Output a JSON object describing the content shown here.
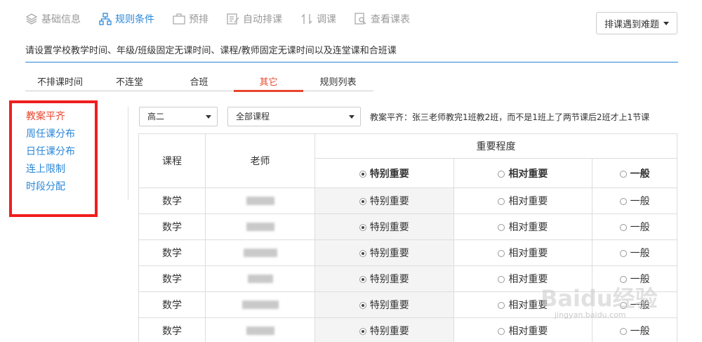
{
  "nav": {
    "items": [
      {
        "label": "基础信息",
        "icon": "layers-icon",
        "active": false
      },
      {
        "label": "规则条件",
        "icon": "sitemap-icon",
        "active": true
      },
      {
        "label": "预排",
        "icon": "briefcase-icon",
        "active": false
      },
      {
        "label": "自动排课",
        "icon": "edit-icon",
        "active": false
      },
      {
        "label": "调课",
        "icon": "swap-icon",
        "active": false
      },
      {
        "label": "查看课表",
        "icon": "search-doc-icon",
        "active": false
      }
    ],
    "trouble_label": "排课遇到难题"
  },
  "description": "请设置学校教学时间、年级/班级固定无课时间、课程/教师固定无课时间以及连堂课和合班课",
  "subtabs": [
    "不排课时间",
    "不连堂",
    "合班",
    "其它",
    "规则列表"
  ],
  "active_subtab": "其它",
  "leftmenu": [
    "教案平齐",
    "周任课分布",
    "日任课分布",
    "连上限制",
    "时段分配"
  ],
  "filters": {
    "grade": "高二",
    "course": "全部课程",
    "hint": "教案平齐：张三老师教完1班教2班，而不是1班上了两节课后2班才上1节课"
  },
  "table": {
    "headers": {
      "course": "课程",
      "teacher": "老师",
      "importance": "重要程度",
      "levels": [
        "特别重要",
        "相对重要",
        "一般"
      ]
    },
    "rows": [
      {
        "course": "数学",
        "selected": "特别重要"
      },
      {
        "course": "数学",
        "selected": "特别重要"
      },
      {
        "course": "数学",
        "selected": "特别重要"
      },
      {
        "course": "数学",
        "selected": "特别重要"
      },
      {
        "course": "数学",
        "selected": "特别重要"
      },
      {
        "course": "数学",
        "selected": "特别重要"
      }
    ]
  },
  "colors": {
    "accent": "#2b87d8",
    "active_red": "#e8452c",
    "highlight_box": "#f01e1e"
  },
  "watermark": {
    "main": "Baidu经验",
    "sub": "jingyan.baidu.com"
  }
}
